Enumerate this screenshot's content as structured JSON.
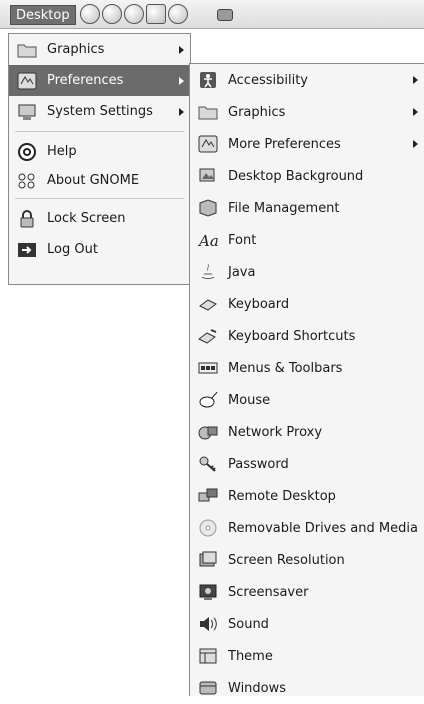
{
  "panel": {
    "desktop_label": "Desktop",
    "launcher_icons": [
      "web-browser-icon",
      "email-icon",
      "terminal-icon",
      "text-editor-icon",
      "help-icon"
    ],
    "tray_icon": "tray-icon"
  },
  "main_menu": {
    "items": [
      {
        "label": "Graphics",
        "icon": "folder-icon",
        "submenu": true
      },
      {
        "label": "Preferences",
        "icon": "preferences-icon",
        "submenu": true,
        "active": true
      },
      {
        "label": "System Settings",
        "icon": "system-settings-icon",
        "submenu": true
      },
      {
        "label": "Help",
        "icon": "help-icon"
      },
      {
        "label": "About GNOME",
        "icon": "gnome-footprint-icon"
      },
      {
        "label": "Lock Screen",
        "icon": "lock-icon"
      },
      {
        "label": "Log Out",
        "icon": "logout-icon"
      }
    ]
  },
  "preferences_menu": {
    "items": [
      {
        "label": "Accessibility",
        "icon": "accessibility-icon",
        "submenu": true
      },
      {
        "label": "Graphics",
        "icon": "folder-icon",
        "submenu": true
      },
      {
        "label": "More Preferences",
        "icon": "preferences-icon",
        "submenu": true
      },
      {
        "label": "Desktop Background",
        "icon": "desktop-background-icon"
      },
      {
        "label": "File Management",
        "icon": "file-management-icon"
      },
      {
        "label": "Font",
        "icon": "font-icon"
      },
      {
        "label": "Java",
        "icon": "java-icon"
      },
      {
        "label": "Keyboard",
        "icon": "keyboard-icon"
      },
      {
        "label": "Keyboard Shortcuts",
        "icon": "keyboard-shortcuts-icon"
      },
      {
        "label": "Menus & Toolbars",
        "icon": "menus-toolbars-icon"
      },
      {
        "label": "Mouse",
        "icon": "mouse-icon"
      },
      {
        "label": "Network Proxy",
        "icon": "network-proxy-icon"
      },
      {
        "label": "Password",
        "icon": "password-icon"
      },
      {
        "label": "Remote Desktop",
        "icon": "remote-desktop-icon"
      },
      {
        "label": "Removable Drives and Media",
        "icon": "removable-media-icon"
      },
      {
        "label": "Screen Resolution",
        "icon": "screen-resolution-icon"
      },
      {
        "label": "Screensaver",
        "icon": "screensaver-icon"
      },
      {
        "label": "Sound",
        "icon": "sound-icon"
      },
      {
        "label": "Theme",
        "icon": "theme-icon"
      },
      {
        "label": "Windows",
        "icon": "windows-icon"
      }
    ]
  }
}
